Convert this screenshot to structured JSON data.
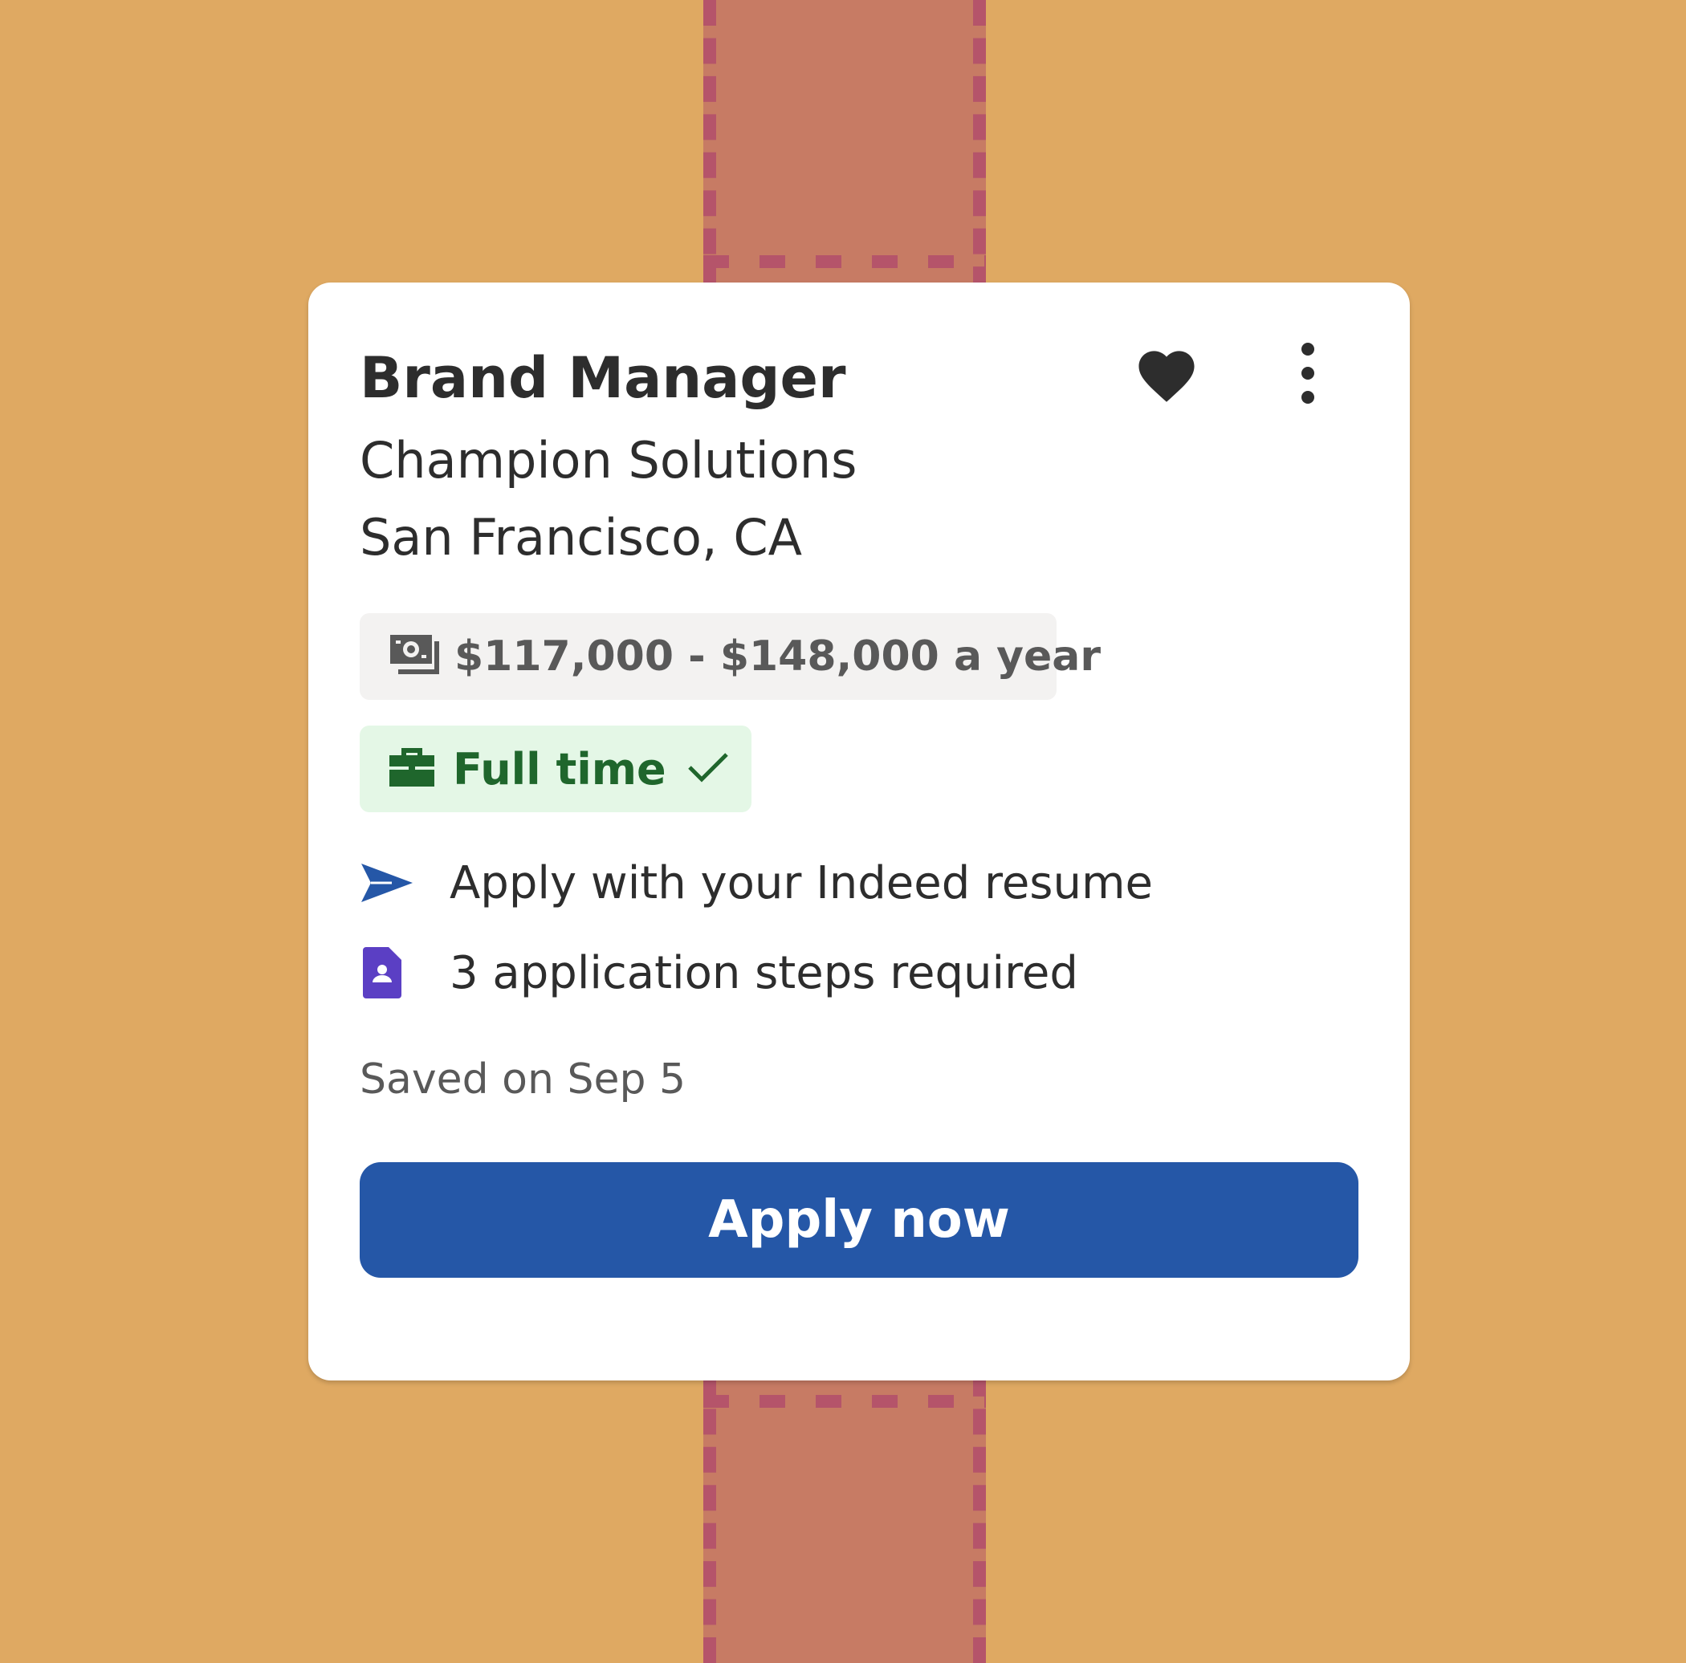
{
  "job": {
    "title": "Brand Manager",
    "company": "Champion Solutions",
    "location": "San Francisco, CA"
  },
  "actions": {
    "save_icon": "heart-icon",
    "more_icon": "more-vertical-icon",
    "is_saved": true
  },
  "tags": {
    "salary": {
      "icon": "money-icon",
      "label": "$117,000 - $148,000 a year"
    },
    "job_type": {
      "icon": "briefcase-icon",
      "label": "Full time",
      "status_icon": "check-icon"
    }
  },
  "details": [
    {
      "icon": "send-icon",
      "text": "Apply with your Indeed resume"
    },
    {
      "icon": "resume-document-icon",
      "text": "3 application steps required"
    }
  ],
  "saved_text": "Saved on Sep 5",
  "apply_button": {
    "label": "Apply now"
  },
  "colors": {
    "background": "#dfa962",
    "ribbon": "#c77b64",
    "ribbon_dash": "#b5546a",
    "primary": "#2557a7",
    "job_type_bg": "#e4f7e6",
    "job_type_text": "#1f662c",
    "salary_bg": "#f3f2f1",
    "steps_icon": "#5b3fc4"
  }
}
